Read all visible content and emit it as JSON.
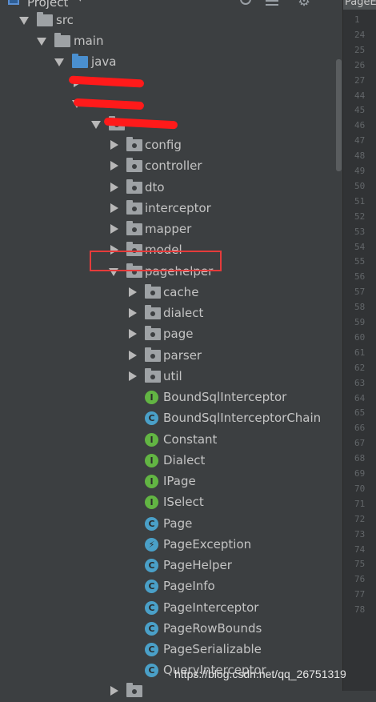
{
  "header": {
    "title": "Project",
    "tab_title": "PageE"
  },
  "tree": {
    "src": "src",
    "main": "main",
    "java": "java",
    "packages": [
      "config",
      "controller",
      "dto",
      "interceptor",
      "mapper",
      "model"
    ],
    "pagehelper": "pagehelper",
    "subpackages": [
      "cache",
      "dialect",
      "page",
      "parser",
      "util"
    ],
    "classes": [
      {
        "name": "BoundSqlInterceptor",
        "kind": "I"
      },
      {
        "name": "BoundSqlInterceptorChain",
        "kind": "C"
      },
      {
        "name": "Constant",
        "kind": "I"
      },
      {
        "name": "Dialect",
        "kind": "I"
      },
      {
        "name": "IPage",
        "kind": "I"
      },
      {
        "name": "ISelect",
        "kind": "I"
      },
      {
        "name": "Page",
        "kind": "C"
      },
      {
        "name": "PageException",
        "kind": "E"
      },
      {
        "name": "PageHelper",
        "kind": "C"
      },
      {
        "name": "PageInfo",
        "kind": "C"
      },
      {
        "name": "PageInterceptor",
        "kind": "C"
      },
      {
        "name": "PageRowBounds",
        "kind": "C"
      },
      {
        "name": "PageSerializable",
        "kind": "C"
      },
      {
        "name": "QueryInterceptor",
        "kind": "C"
      }
    ]
  },
  "gutter": {
    "line_numbers": [
      "1",
      "24",
      "25",
      "26",
      "27",
      "44",
      "45",
      "46",
      "47",
      "48",
      "49",
      "50",
      "51",
      "52",
      "53",
      "54",
      "55",
      "56",
      "57",
      "58",
      "59",
      "60",
      "61",
      "62",
      "63",
      "64",
      "65",
      "66",
      "67",
      "68",
      "69",
      "70",
      "71",
      "72",
      "73",
      "74",
      "75",
      "76",
      "77",
      "78"
    ]
  },
  "watermark": "https://blog.csdn.net/qq_26751319",
  "colors": {
    "background": "#3c3f41",
    "interface_badge": "#62b543",
    "class_badge": "#4aa0c8",
    "highlight": "#e53b3b"
  }
}
